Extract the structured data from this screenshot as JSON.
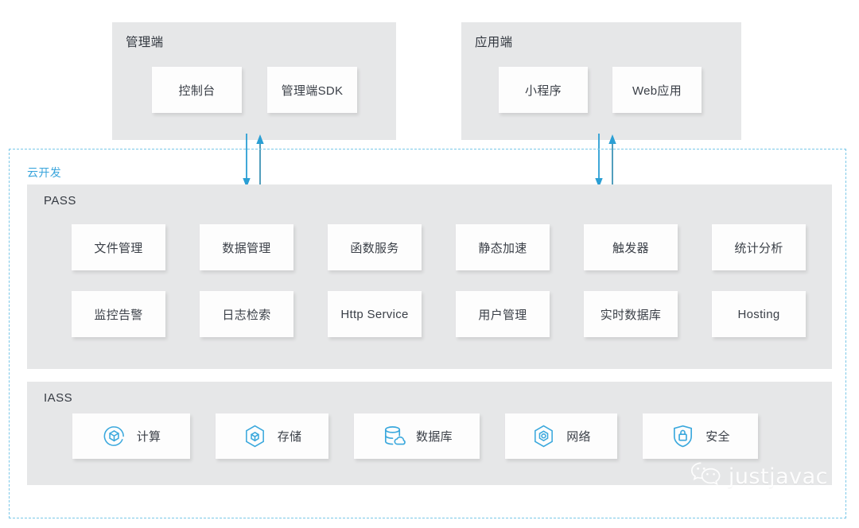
{
  "clients": [
    {
      "id": "admin",
      "title": "管理端",
      "cards": [
        {
          "label": "控制台"
        },
        {
          "label": "管理端SDK"
        }
      ]
    },
    {
      "id": "app",
      "title": "应用端",
      "cards": [
        {
          "label": "小程序"
        },
        {
          "label": "Web应用"
        }
      ]
    }
  ],
  "cloud": {
    "label": "云开发",
    "border_color": "#79c7e8",
    "label_color": "#3aa5dc"
  },
  "arrows": {
    "color": "#2b9fd4",
    "down_icon": "arrow-down-icon",
    "up_icon": "arrow-up-icon",
    "groups": [
      {
        "id": "left",
        "from": "管理端",
        "to": "云开发"
      },
      {
        "id": "right",
        "from": "应用端",
        "to": "云开发"
      }
    ]
  },
  "pass": {
    "title": "PASS",
    "items": [
      {
        "label": "文件管理"
      },
      {
        "label": "数据管理"
      },
      {
        "label": "函数服务"
      },
      {
        "label": "静态加速"
      },
      {
        "label": "触发器"
      },
      {
        "label": "统计分析"
      },
      {
        "label": "监控告警"
      },
      {
        "label": "日志检索"
      },
      {
        "label": "Http Service"
      },
      {
        "label": "用户管理"
      },
      {
        "label": "实时数据库"
      },
      {
        "label": "Hosting"
      }
    ]
  },
  "iass": {
    "title": "IASS",
    "icon_color": "#3aa8dd",
    "items": [
      {
        "label": "计算",
        "icon": "compute-circle-cube-icon"
      },
      {
        "label": "存储",
        "icon": "storage-hexagon-cube-icon"
      },
      {
        "label": "数据库",
        "icon": "database-cylinder-cloud-icon"
      },
      {
        "label": "网络",
        "icon": "network-hexagon-node-icon"
      },
      {
        "label": "安全",
        "icon": "security-shield-lock-icon"
      }
    ]
  },
  "watermark": {
    "text": "justjavac",
    "icon": "wechat-icon",
    "color": "#ffffff"
  },
  "palette": {
    "panel_grey": "#e6e7e8",
    "card_white": "#fdfdfd",
    "text_dark": "#3a3f47",
    "accent_blue": "#3aa5dc"
  }
}
